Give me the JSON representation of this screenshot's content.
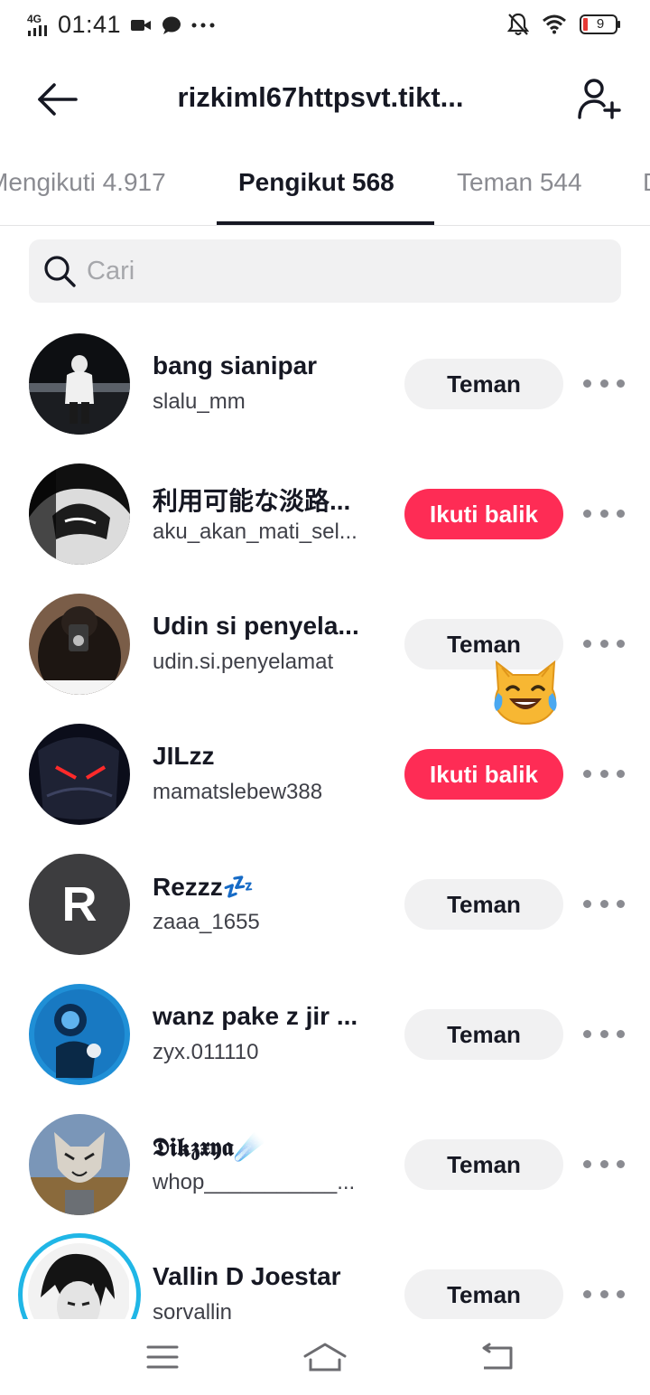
{
  "status_bar": {
    "time": "01:41",
    "network": "4G",
    "battery": "9"
  },
  "header": {
    "title": "rizkiml67httpsvt.tikt..."
  },
  "tabs": [
    {
      "label": "Mengikuti 4.917"
    },
    {
      "label": "Pengikut 568"
    },
    {
      "label": "Teman 544"
    },
    {
      "label": "D"
    }
  ],
  "search": {
    "placeholder": "Cari"
  },
  "followers": [
    {
      "name": "bang sianipar",
      "handle": "slalu_mm",
      "button": "Teman"
    },
    {
      "name": "利用可能な淡路...",
      "handle": "aku_akan_mati_sel...",
      "button": "Ikuti balik"
    },
    {
      "name": "Udin si penyela...",
      "handle": "udin.si.penyelamat",
      "button": "Teman"
    },
    {
      "name": "JILzz",
      "handle": "mamatslebew388",
      "button": "Ikuti balik"
    },
    {
      "name": "Rezzz💤",
      "handle": "zaaa_1655",
      "button": "Teman",
      "avatar_letter": "R"
    },
    {
      "name": "wanz pake z jir ...",
      "handle": "zyx.011110",
      "button": "Teman"
    },
    {
      "name": "𝕯𝖎𝖐𝖟𝖝𝖞𝖆☄️",
      "handle": "whop___________...",
      "button": "Teman"
    },
    {
      "name": "Vallin D Joestar",
      "handle": "sorvallin",
      "button": "Teman"
    }
  ],
  "colors": {
    "accent": "#fe2c55",
    "friend_button": "#f1f1f2",
    "story_ring": "#20b6e6"
  },
  "emoji_overlay": "😹"
}
